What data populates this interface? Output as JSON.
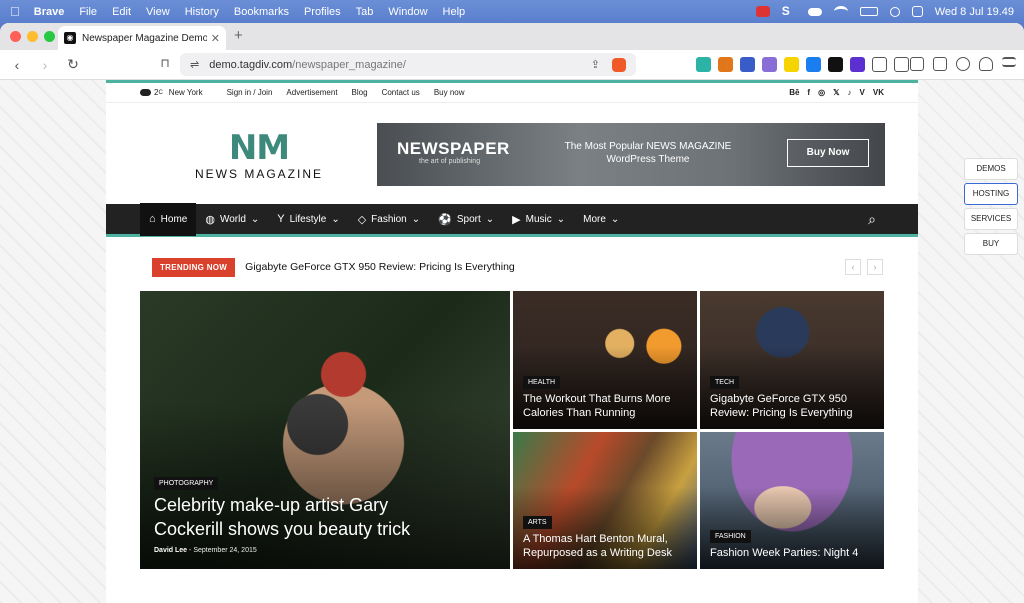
{
  "menubar": {
    "app": "Brave",
    "items": [
      "File",
      "Edit",
      "View",
      "History",
      "Bookmarks",
      "Profiles",
      "Tab",
      "Window",
      "Help"
    ],
    "clock": "Wed 8 Jul  19.49"
  },
  "browser": {
    "tab_title": "Newspaper Magazine Demo | ...",
    "url_host": "demo.tagdiv.com",
    "url_path": "/newspaper_magazine/"
  },
  "topbar": {
    "temp": "2",
    "temp_unit": "C",
    "city": "New York",
    "links": [
      "Sign in / Join",
      "Advertisement",
      "Blog",
      "Contact us",
      "Buy now"
    ],
    "social": [
      "Bē",
      "f",
      "◎",
      "𝕏",
      "♪",
      "V",
      "VK"
    ]
  },
  "header": {
    "logo_main": "NM",
    "logo_sub": "NEWS  MAGAZINE",
    "banner_brand": "NEWSPAPER",
    "banner_tagline": "the art of publishing",
    "banner_text_1": "The Most Popular NEWS MAGAZINE",
    "banner_text_2": "WordPress Theme",
    "banner_cta": "Buy Now"
  },
  "nav": {
    "items": [
      {
        "label": "Home",
        "icon": "⌂"
      },
      {
        "label": "World",
        "icon": "◍"
      },
      {
        "label": "Lifestyle",
        "icon": "Y"
      },
      {
        "label": "Fashion",
        "icon": "◇"
      },
      {
        "label": "Sport",
        "icon": "⚽"
      },
      {
        "label": "Music",
        "icon": "▶"
      },
      {
        "label": "More",
        "icon": ""
      }
    ]
  },
  "trending": {
    "label": "TRENDING NOW",
    "headline": "Gigabyte GeForce GTX 950 Review: Pricing Is Everything"
  },
  "cards": [
    {
      "category": "PHOTOGRAPHY",
      "title": "Celebrity make-up artist Gary Cockerill shows you beauty trick",
      "author": "David Lee",
      "date": "September 24, 2015",
      "color": "#2f3a2c"
    },
    {
      "category": "HEALTH",
      "title": "The Workout That Burns More Calories Than Running",
      "color": "#3a2a22"
    },
    {
      "category": "TECH",
      "title": "Gigabyte GeForce GTX 950 Review: Pricing Is Everything",
      "color": "#3b2f2a"
    },
    {
      "category": "ARTS",
      "title": "A Thomas Hart Benton Mural, Repurposed as a Writing Desk",
      "color": "#5a4a3a"
    },
    {
      "category": "FASHION",
      "title": "Fashion Week Parties: Night 4",
      "color": "#5c6a7a"
    }
  ],
  "float_buttons": [
    "DEMOS",
    "HOSTING",
    "SERVICES",
    "BUY"
  ]
}
